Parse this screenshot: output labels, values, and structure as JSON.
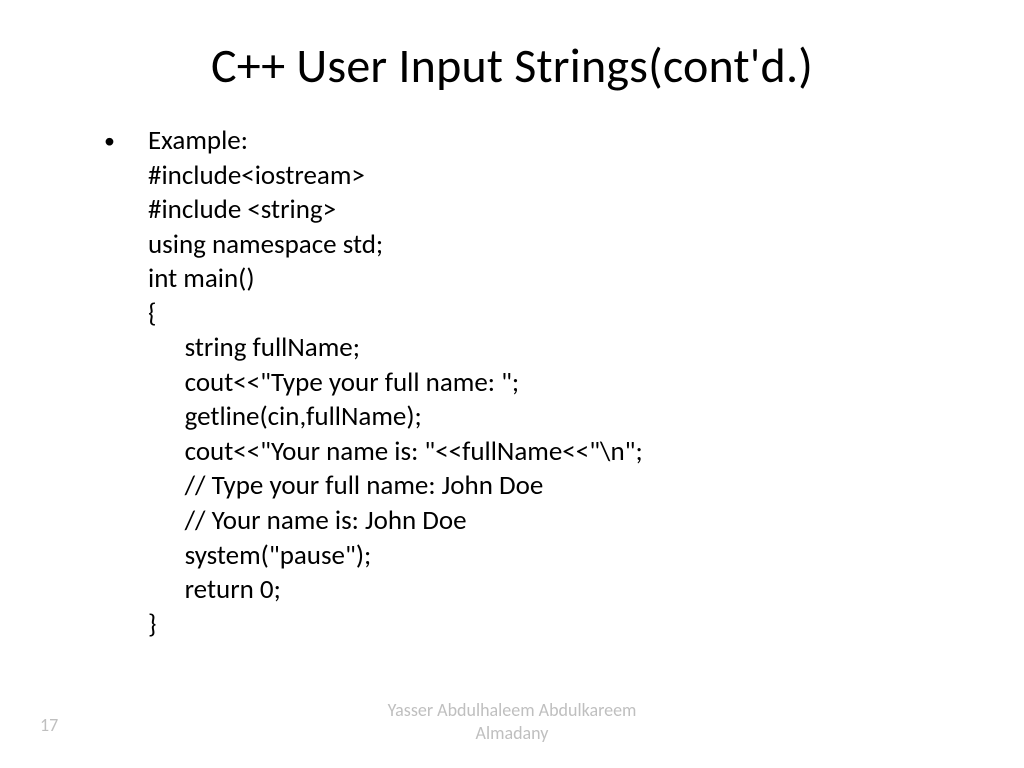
{
  "title": "C++ User Input Strings(cont'd.)",
  "bullet_label": "Example:",
  "code_lines": [
    "#include<iostream>",
    "#include <string>",
    "using namespace std;",
    "int main()",
    "{",
    "      string fullName;",
    "      cout<<\"Type your full name: \";",
    "      getline(cin,fullName);",
    "      cout<<\"Your name is: \"<<fullName<<\"\\n\";",
    "      // Type your full name: John Doe",
    "      // Your name is: John Doe",
    "      system(\"pause\");",
    "      return 0;",
    "}"
  ],
  "footer": {
    "author_line1": "Yasser Abdulhaleem Abdulkareem",
    "author_line2": "Almadany",
    "page": "17"
  }
}
